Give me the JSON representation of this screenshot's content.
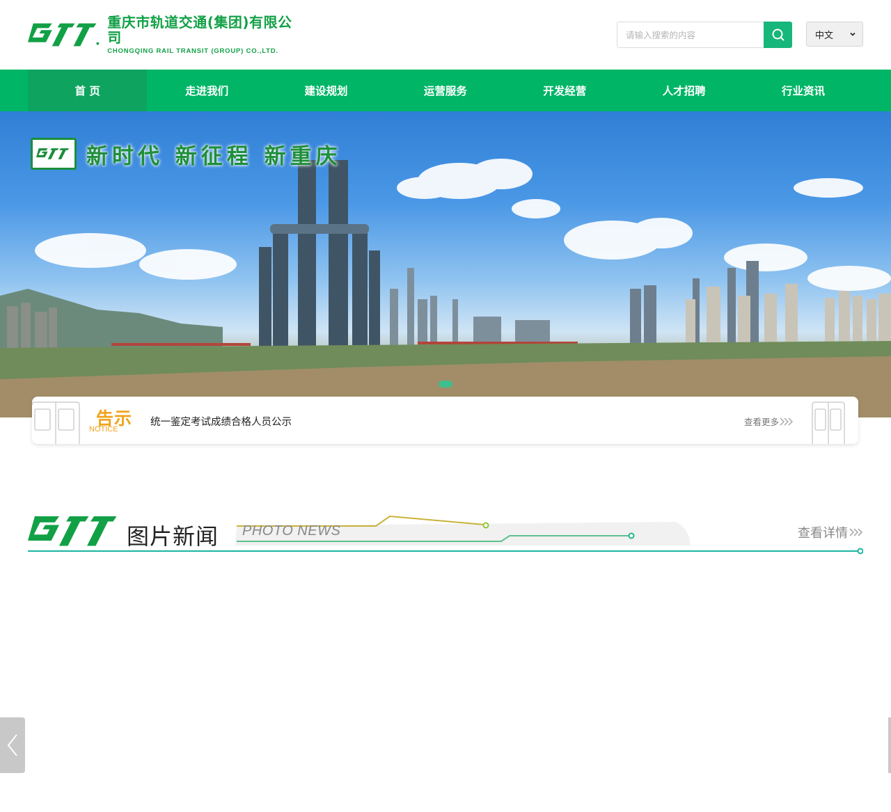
{
  "header": {
    "logo_cn": "重庆市轨道交通(集团)有限公司",
    "logo_en": "CHONGQING RAIL TRANSIT (GROUP) CO.,LTD.",
    "search_placeholder": "请输入搜索的内容",
    "search_icon": "search-icon",
    "language": "中文"
  },
  "nav": {
    "items": [
      "首 页",
      "走进我们",
      "建设规划",
      "运营服务",
      "开发经营",
      "人才招聘",
      "行业资讯"
    ],
    "active_index": 0
  },
  "banner": {
    "slogan": "新时代 新征程 新重庆"
  },
  "notice": {
    "badge_cn": "告示",
    "badge_en": "NOTICE",
    "text": "统一鉴定考试成绩合格人员公示",
    "more": "查看更多"
  },
  "photo_news": {
    "title": "图片新闻",
    "title_en": "PHOTO NEWS",
    "more": "查看详情"
  },
  "colors": {
    "brand_green": "#00b566",
    "nav_active": "#0ea460",
    "search_button": "#17b67a",
    "notice_orange": "#f0a31d"
  }
}
